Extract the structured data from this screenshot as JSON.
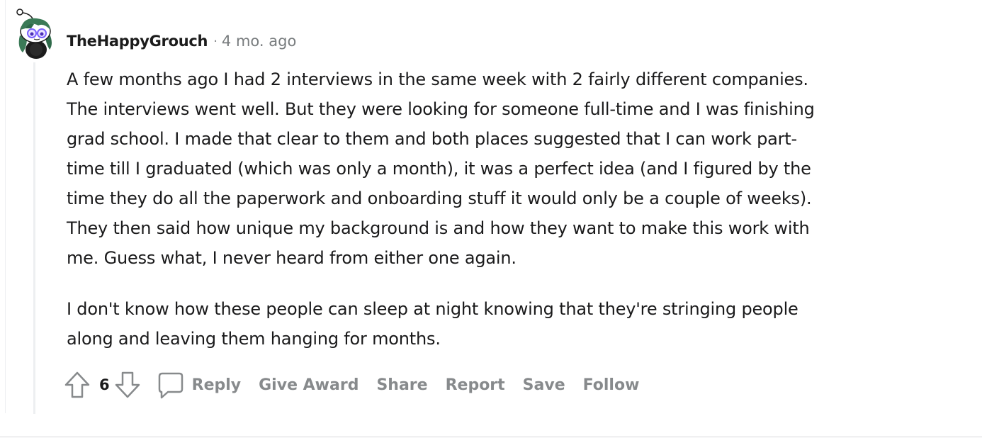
{
  "comment": {
    "author": "TheHappyGrouch",
    "separator": "·",
    "age": "4 mo. ago",
    "paragraphs": [
      "A few months ago I had 2 interviews in the same week with 2 fairly different companies.\nThe interviews went well. But they were looking for someone full-time and I was finishing\ngrad school. I made that clear to them and both places suggested that I can work part-\ntime till I graduated (which was only a month), it was a perfect idea (and I figured by the\ntime they do all the paperwork and onboarding stuff it would only be a couple of weeks).\nThey then said how unique my background is and how they want to make this work with\nme. Guess what, I never heard from either one again.",
      "I don't know how these people can sleep at night knowing that they're stringing people\nalong and leaving them hanging for months."
    ],
    "score": "6"
  },
  "actions": {
    "reply": "Reply",
    "give_award": "Give Award",
    "share": "Share",
    "report": "Report",
    "save": "Save",
    "follow": "Follow"
  },
  "icons": {
    "avatar": "snoo-avatar",
    "upvote": "upvote-arrow-icon",
    "downvote": "downvote-arrow-icon",
    "reply": "comment-bubble-icon"
  },
  "colors": {
    "muted_text": "#878a8c",
    "thread_line": "#edeff1",
    "avatar_hair": "#3b7a57",
    "avatar_glasses": "#7b61ff"
  }
}
